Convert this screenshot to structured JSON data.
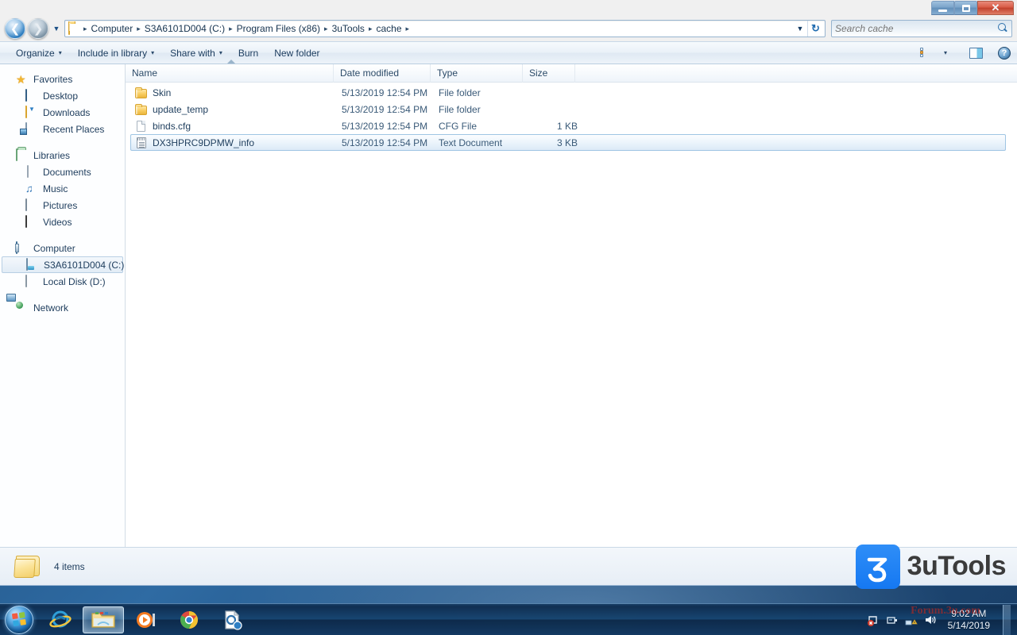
{
  "window": {
    "controls": {
      "minimize": "Minimize",
      "maximize": "Maximize",
      "close": "Close"
    }
  },
  "address": {
    "crumbs": [
      "Computer",
      "S3A6101D004 (C:)",
      "Program Files (x86)",
      "3uTools",
      "cache"
    ],
    "separator": "▸",
    "dropdown": "▼",
    "refresh": "↻"
  },
  "search": {
    "placeholder": "Search cache",
    "value": ""
  },
  "toolbar": {
    "organize": "Organize",
    "include_in_library": "Include in library",
    "share_with": "Share with",
    "burn": "Burn",
    "new_folder": "New folder",
    "caret": "▾",
    "help": "?"
  },
  "navpane": {
    "groups": [
      {
        "header": {
          "label": "Favorites",
          "icon": "star-icon"
        },
        "items": [
          {
            "label": "Desktop",
            "icon": "desktop-icon"
          },
          {
            "label": "Downloads",
            "icon": "downloads-icon"
          },
          {
            "label": "Recent Places",
            "icon": "recent-places-icon"
          }
        ]
      },
      {
        "header": {
          "label": "Libraries",
          "icon": "libraries-icon"
        },
        "items": [
          {
            "label": "Documents",
            "icon": "documents-icon"
          },
          {
            "label": "Music",
            "icon": "music-icon"
          },
          {
            "label": "Pictures",
            "icon": "pictures-icon"
          },
          {
            "label": "Videos",
            "icon": "videos-icon"
          }
        ]
      },
      {
        "header": {
          "label": "Computer",
          "icon": "computer-icon"
        },
        "items": [
          {
            "label": "S3A6101D004 (C:)",
            "icon": "hard-drive-icon",
            "selected": true
          },
          {
            "label": "Local Disk (D:)",
            "icon": "local-disk-icon"
          }
        ]
      },
      {
        "header": {
          "label": "Network",
          "icon": "network-icon"
        },
        "items": []
      }
    ]
  },
  "filelist": {
    "columns": [
      "Name",
      "Date modified",
      "Type",
      "Size"
    ],
    "sorted_by": "Name",
    "rows": [
      {
        "name": "Skin",
        "date": "5/13/2019 12:54 PM",
        "type": "File folder",
        "size": "",
        "icon": "folder-icon",
        "selected": false
      },
      {
        "name": "update_temp",
        "date": "5/13/2019 12:54 PM",
        "type": "File folder",
        "size": "",
        "icon": "folder-icon",
        "selected": false
      },
      {
        "name": "binds.cfg",
        "date": "5/13/2019 12:54 PM",
        "type": "CFG File",
        "size": "1 KB",
        "icon": "file-icon",
        "selected": false
      },
      {
        "name": "DX3HPRC9DPMW_info",
        "date": "5/13/2019 12:54 PM",
        "type": "Text Document",
        "size": "3 KB",
        "icon": "text-document-icon",
        "selected": true
      }
    ]
  },
  "statusbar": {
    "item_count": "4 items",
    "watermark_text": "3uTools",
    "watermark_glyph": "3"
  },
  "taskbar": {
    "start": "Start",
    "buttons": [
      {
        "name": "internet-explorer",
        "label": "Internet Explorer"
      },
      {
        "name": "windows-explorer",
        "label": "Windows Explorer",
        "active": true
      },
      {
        "name": "windows-media-player",
        "label": "Windows Media Player"
      },
      {
        "name": "google-chrome",
        "label": "Google Chrome"
      },
      {
        "name": "search-tool",
        "label": "Search"
      }
    ],
    "tray_watermark": "Forum.3u.com",
    "clock": {
      "time": "9:02 AM",
      "date": "5/14/2019"
    }
  },
  "colors": {
    "accent": "#1578f2",
    "selection_border": "#9fc5e3",
    "folder_yellow": "#f9cf63",
    "desktop_blue": "#24598c"
  }
}
